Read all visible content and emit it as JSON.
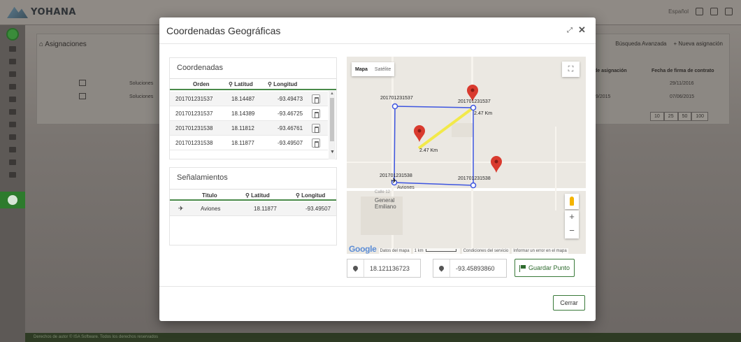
{
  "app": {
    "logo_text": "YOHANA",
    "language": "Español",
    "breadcrumb": "Asignaciones",
    "actions": {
      "advanced_search": "Búsqueda Avanzada",
      "new_assignment": "Nueva asignación"
    },
    "columns": {
      "assignment_date": "de asignación",
      "contract_date": "Fecha de firma de contrato"
    },
    "rows": [
      {
        "company": "Soluciones",
        "assignment_date": "",
        "contract_date": "29/11/2016"
      },
      {
        "company": "Soluciones",
        "assignment_date": "9/2015",
        "contract_date": "07/06/2015"
      }
    ],
    "page_sizes": [
      "10",
      "25",
      "50",
      "100"
    ],
    "footer": "Derechos de autor © ISA Software. Todos los derechos reservados"
  },
  "modal": {
    "title": "Coordenadas Geográficas",
    "coords_panel": {
      "heading": "Coordenadas",
      "headers": {
        "orden": "Orden",
        "latitud": "Latitud",
        "longitud": "Longitud"
      },
      "rows": [
        {
          "orden": "201701231537",
          "lat": "18.14487",
          "lng": "-93.49473"
        },
        {
          "orden": "201701231537",
          "lat": "18.14389",
          "lng": "-93.46725"
        },
        {
          "orden": "201701231538",
          "lat": "18.11812",
          "lng": "-93.46761"
        },
        {
          "orden": "201701231538",
          "lat": "18.11877",
          "lng": "-93.49507"
        }
      ]
    },
    "signs_panel": {
      "heading": "Señalamientos",
      "headers": {
        "titulo": "Titulo",
        "latitud": "Latitud",
        "longitud": "Longitud"
      },
      "rows": [
        {
          "titulo": "Aviones",
          "lat": "18.11877",
          "lng": "-93.49507"
        }
      ]
    },
    "map": {
      "type_map": "Mapa",
      "type_satellite": "Satélite",
      "labels": {
        "top_left": "201701231537",
        "top_right": "201701231537",
        "bottom_left": "201701231538",
        "bottom_right": "201701231538",
        "distance_top": "2.47 Km",
        "distance_center": "2.47 Km",
        "aviones": "Aviones",
        "road": "Calle 12"
      },
      "place": "General\nEmiliano",
      "zoom_in": "+",
      "zoom_out": "−",
      "attribution": {
        "google": "Google",
        "data": "Datos del mapa",
        "scale": "1 km",
        "terms": "Condiciones del servicio",
        "report": "Informar un error en el mapa"
      },
      "colors": {
        "polygon": "#3d55e0",
        "distance_line": "#f2e94a",
        "marker": "#d93a2e"
      }
    },
    "latitude_value": "18.121136723",
    "longitude_value": "-93.45893860",
    "save_label": "Guardar Punto",
    "close_label": "Cerrar"
  }
}
